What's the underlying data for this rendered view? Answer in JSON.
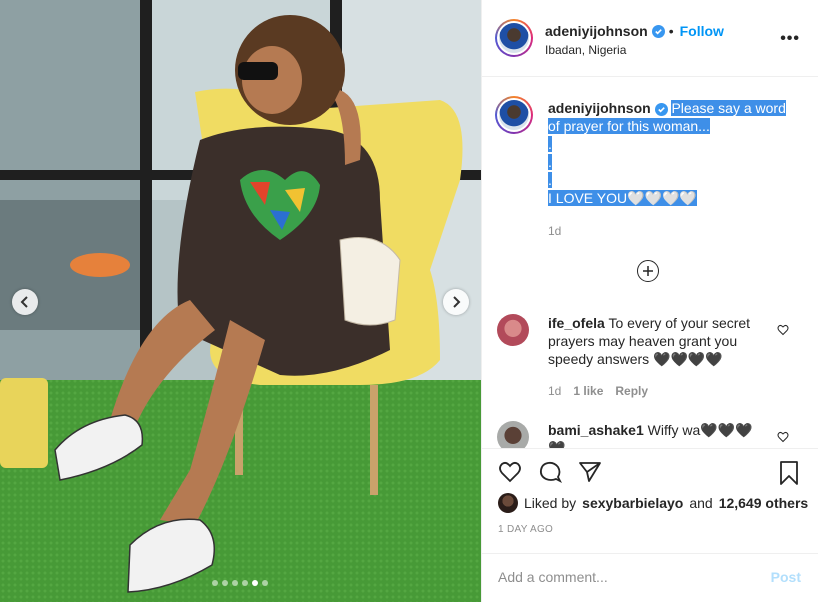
{
  "post": {
    "username": "adeniyijohnson",
    "follow_label": "Follow",
    "location": "Ibadan, Nigeria",
    "more_label": "•••",
    "image_position": {
      "current": 5,
      "total": 6
    }
  },
  "caption": {
    "username": "adeniyijohnson",
    "line1": "Please say a word",
    "line2": "of prayer for this woman...",
    "line3": ".",
    "line4": ".",
    "line5": ".",
    "line6": "I LOVE YOU🤍🤍🤍🤍",
    "time": "1d"
  },
  "comments": [
    {
      "username": "ife_ofela",
      "text": "To every of your secret prayers may heaven grant you speedy answers 🖤🖤🖤🖤",
      "time": "1d",
      "likes": "1 like",
      "reply": "Reply"
    },
    {
      "username": "bami_ashake1",
      "text": "Wiffy wa🖤🖤🖤🖤"
    }
  ],
  "likes": {
    "prefix": "Liked by",
    "user": "sexybarbielayo",
    "and": "and",
    "count": "12,649 others"
  },
  "time_ago": "1 DAY AGO",
  "add_comment": {
    "placeholder": "Add a comment...",
    "post_label": "Post"
  },
  "colors": {
    "link_blue": "#0095f6",
    "selection": "#3e8fe8",
    "muted": "#8e8e8e",
    "post_disabled": "#b2dffc"
  }
}
